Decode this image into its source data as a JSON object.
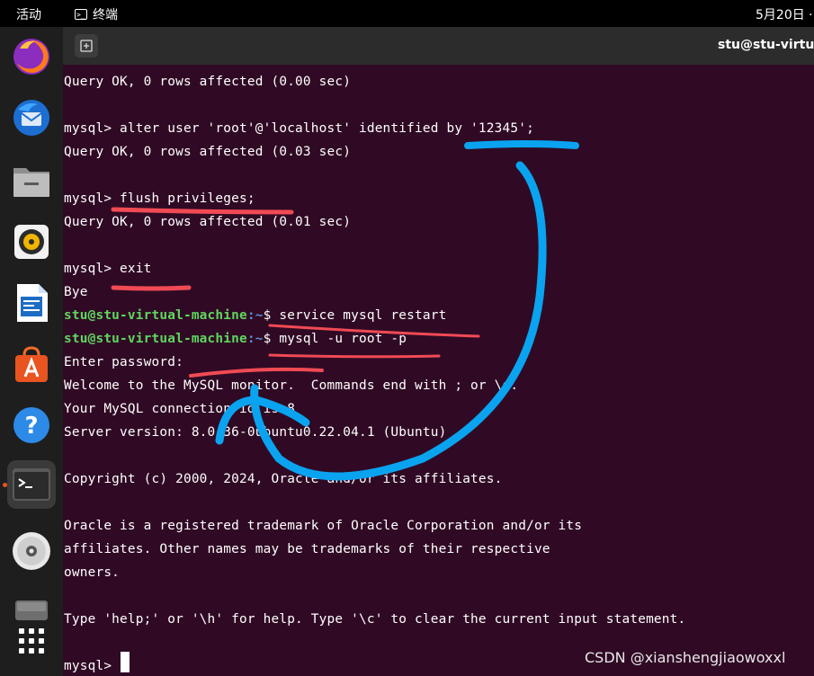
{
  "topbar": {
    "activities": "活动",
    "app_name": "终端",
    "clock": "5月20日 ·"
  },
  "dock": {
    "items": [
      {
        "name": "firefox-icon"
      },
      {
        "name": "thunderbird-icon"
      },
      {
        "name": "files-icon"
      },
      {
        "name": "rhythmbox-icon"
      },
      {
        "name": "libreoffice-writer-icon"
      },
      {
        "name": "app-center-icon"
      },
      {
        "name": "help-icon"
      },
      {
        "name": "terminal-icon",
        "active": true
      },
      {
        "name": "optical-disc-icon"
      },
      {
        "name": "drive-icon"
      },
      {
        "name": "show-apps-icon"
      }
    ]
  },
  "window": {
    "title": "stu@stu-virtua"
  },
  "terminal": {
    "l1": "Query OK, 0 rows affected (0.00 sec)",
    "l3": "mysql> alter user 'root'@'localhost' identified by '12345';",
    "l4": "Query OK, 0 rows affected (0.03 sec)",
    "l6": "mysql> flush privileges;",
    "l7": "Query OK, 0 rows affected (0.01 sec)",
    "l9": "mysql> exit",
    "l10": "Bye",
    "l11_user": "stu@stu-virtual-machine",
    "l11_path": ":~",
    "l11_cmd": "$ service mysql restart",
    "l12_user": "stu@stu-virtual-machine",
    "l12_path": ":~",
    "l12_cmd": "$ mysql -u root -p",
    "l13": "Enter password:",
    "l14": "Welcome to the MySQL monitor.  Commands end with ; or \\g.",
    "l15": "Your MySQL connection id is 8",
    "l16": "Server version: 8.0.36-0ubuntu0.22.04.1 (Ubuntu)",
    "l18": "Copyright (c) 2000, 2024, Oracle and/or its affiliates.",
    "l20": "Oracle is a registered trademark of Oracle Corporation and/or its",
    "l21": "affiliates. Other names may be trademarks of their respective",
    "l22": "owners.",
    "l24": "Type 'help;' or '\\h' for help. Type '\\c' to clear the current input statement.",
    "l26": "mysql> "
  },
  "watermark": "CSDN @xianshengjiaowoxxl",
  "colors": {
    "terminal_bg": "#300a24",
    "prompt_user": "#5fd75f",
    "prompt_path": "#5c8fd6",
    "annotation_red": "#f04a55",
    "annotation_blue": "#0aa3f0"
  }
}
